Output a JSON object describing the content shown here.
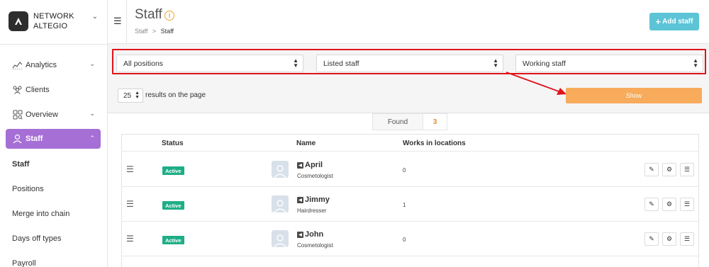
{
  "brand": {
    "line1": "NETWORK",
    "line2": "ALTEGIO"
  },
  "nav": [
    {
      "label": "Analytics",
      "icon": "analytics-icon",
      "has_chevron": true
    },
    {
      "label": "Clients",
      "icon": "clients-icon",
      "has_chevron": false
    },
    {
      "label": "Overview",
      "icon": "overview-icon",
      "has_chevron": true
    },
    {
      "label": "Staff",
      "icon": "staff-icon",
      "has_chevron": true,
      "active": true
    }
  ],
  "subnav": [
    "Staff",
    "Positions",
    "Merge into chain",
    "Days off types",
    "Payroll"
  ],
  "header": {
    "title": "Staff",
    "info_icon": "info-icon",
    "breadcrumb": {
      "root": "Staff",
      "sep": ">",
      "current": "Staff"
    },
    "add_button": "Add staff"
  },
  "filters": {
    "position": "All positions",
    "listing": "Listed staff",
    "working": "Working staff",
    "per_page": "25",
    "per_page_label": "results on the page",
    "show_button": "Show"
  },
  "found": {
    "label": "Found",
    "count": "3"
  },
  "table": {
    "headers": {
      "status": "Status",
      "name": "Name",
      "works": "Works in locations"
    },
    "rows": [
      {
        "status": "Active",
        "name": "April",
        "position": "Cosmetologist",
        "works": "0"
      },
      {
        "status": "Active",
        "name": "Jimmy",
        "position": "Hairdresser",
        "works": "1"
      },
      {
        "status": "Active",
        "name": "John",
        "position": "Cosmetologist",
        "works": "0"
      }
    ]
  },
  "colors": {
    "accent_purple": "#a66fd6",
    "add_button": "#5cc4d6",
    "show_button": "#f7ab5b",
    "active_badge": "#1eae87",
    "annotation_red": "#e0141b",
    "found_count": "#e98a2e"
  }
}
